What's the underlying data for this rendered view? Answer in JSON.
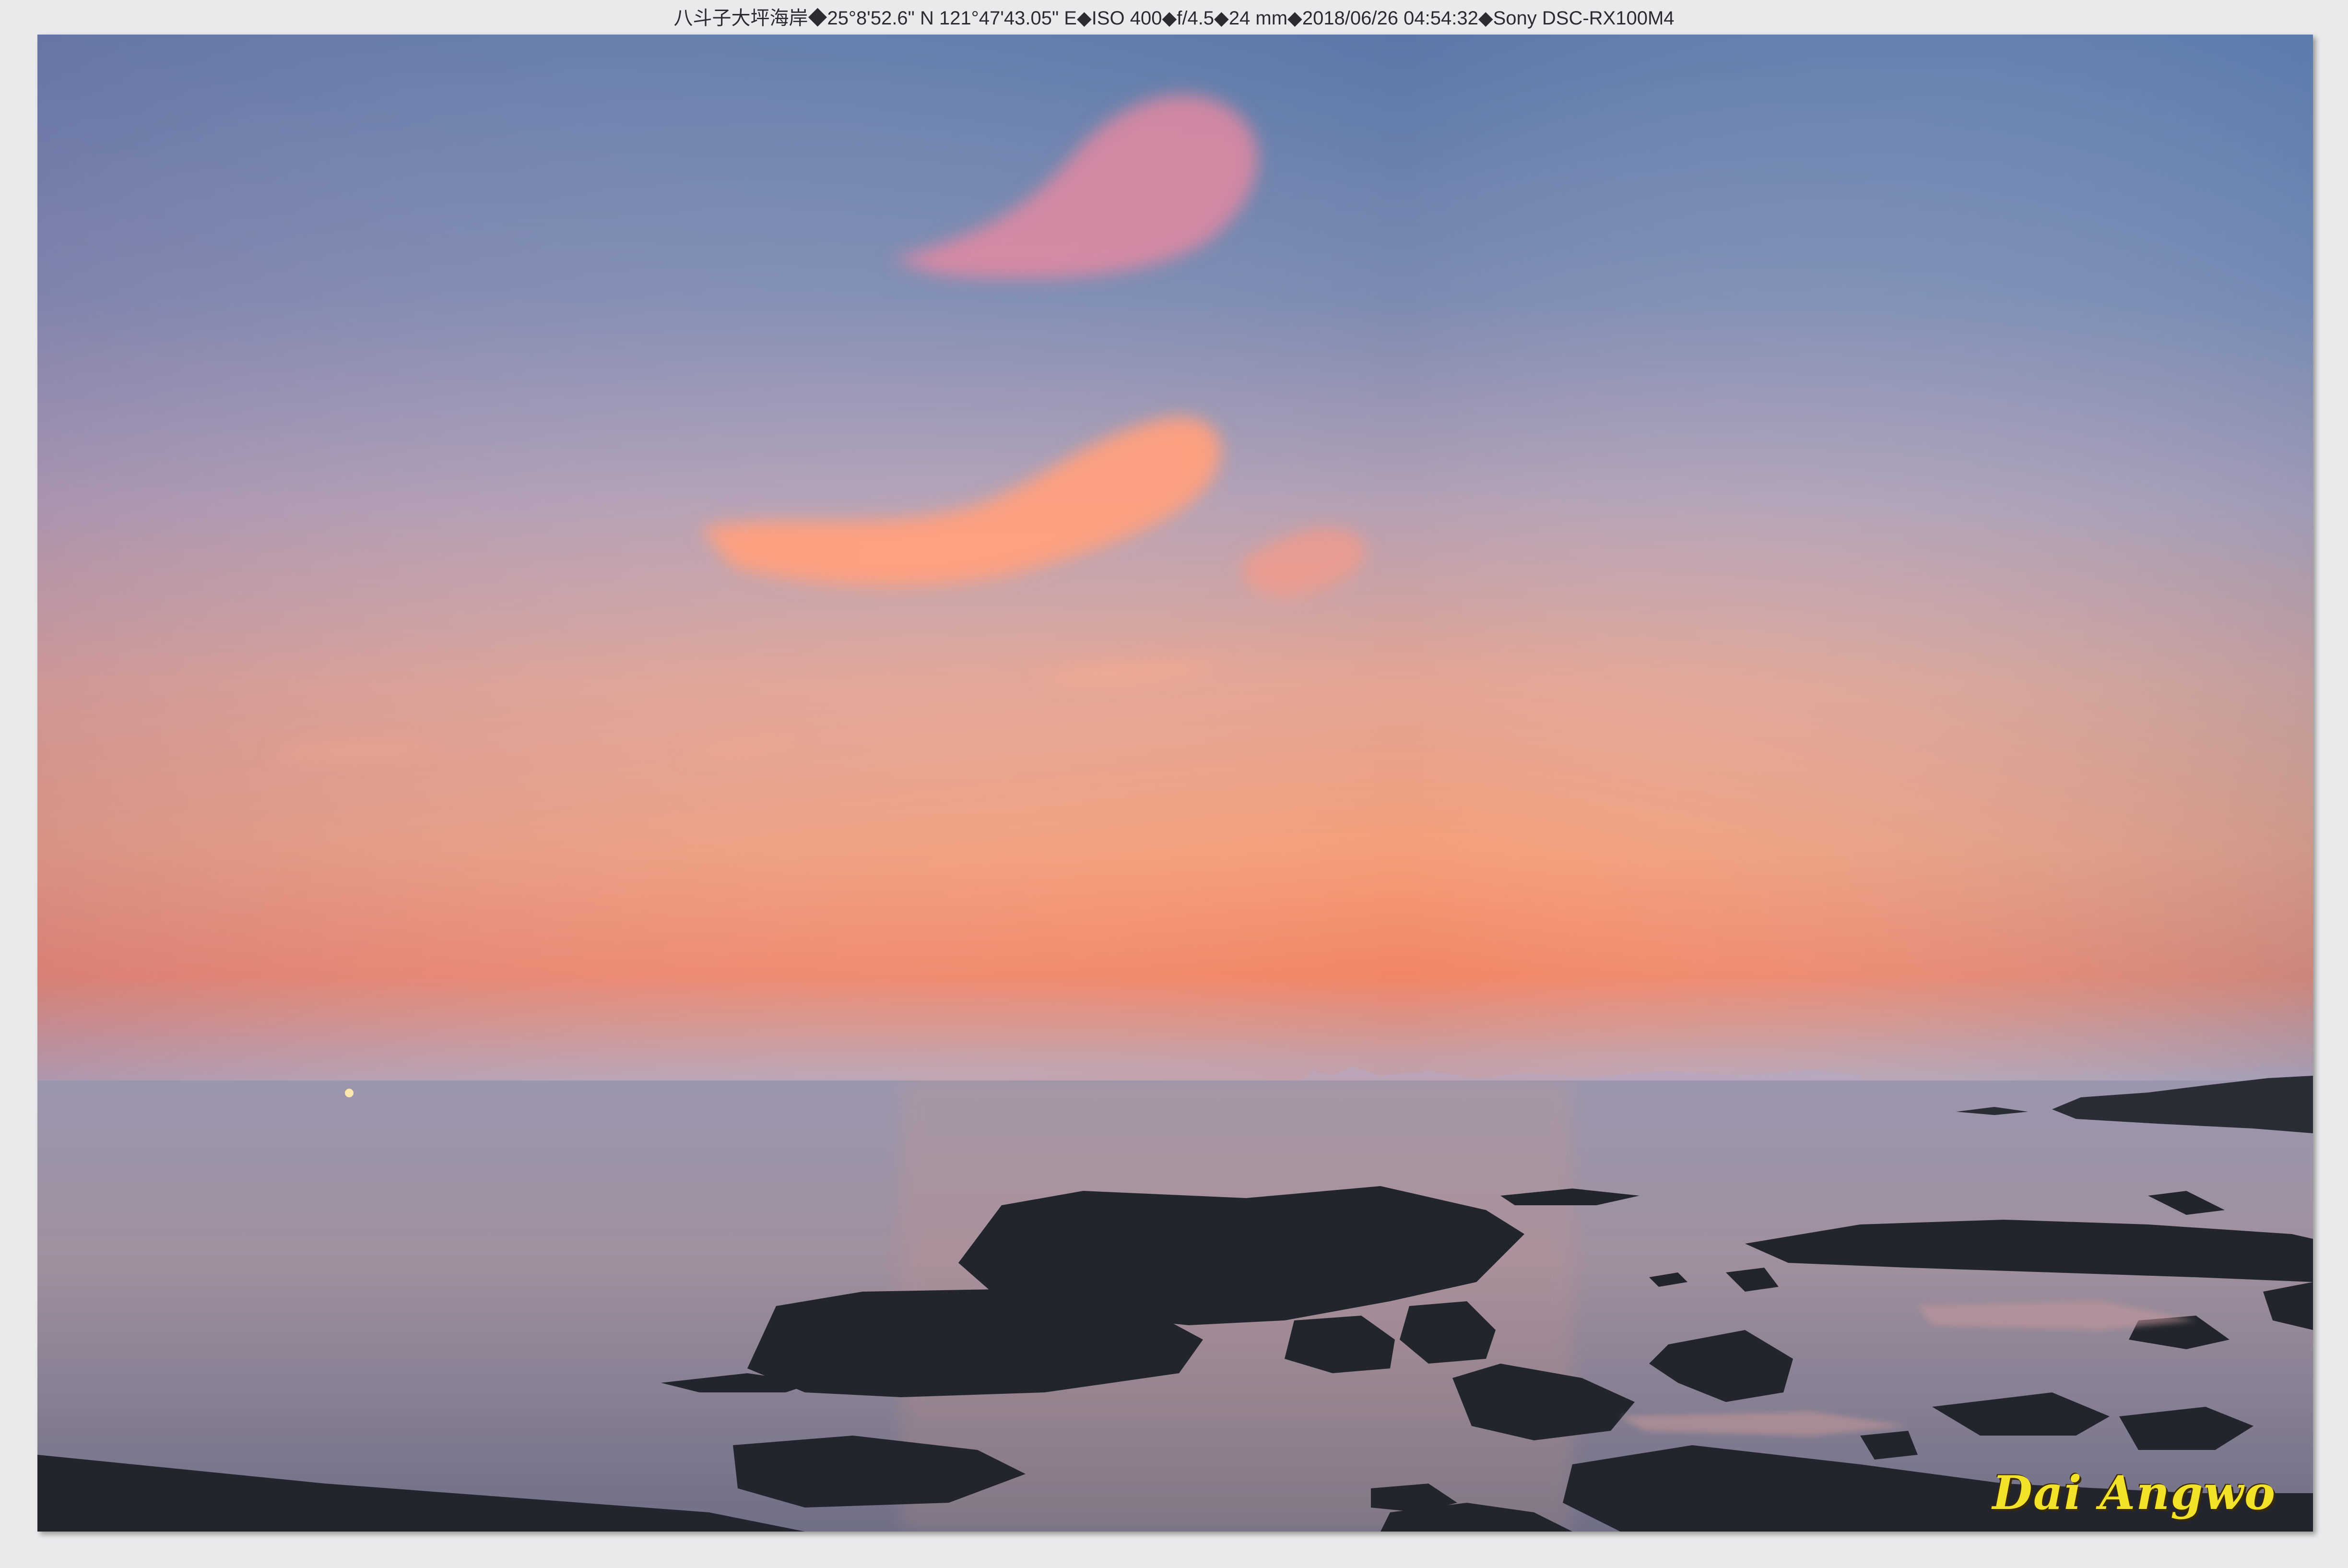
{
  "caption": {
    "text": "八斗子大坪海岸◆25°8'52.6\" N 121°47'43.05\" E◆ISO 400◆f/4.5◆24 mm◆2018/06/26 04:54:32◆Sony DSC-RX100M4"
  },
  "watermark": {
    "text": "Dai Angwo",
    "color": "#f2e22a"
  },
  "scene": {
    "subject": "dawn-sky-over-rocky-coast",
    "colors": {
      "sky_top": "#5f7fae",
      "sky_mid": "#c6a3a8",
      "horizon_glow": "#f07a5a",
      "sea": "#8a8aa2",
      "rock": "#22252d",
      "cloud": "#ff9a7a"
    }
  }
}
